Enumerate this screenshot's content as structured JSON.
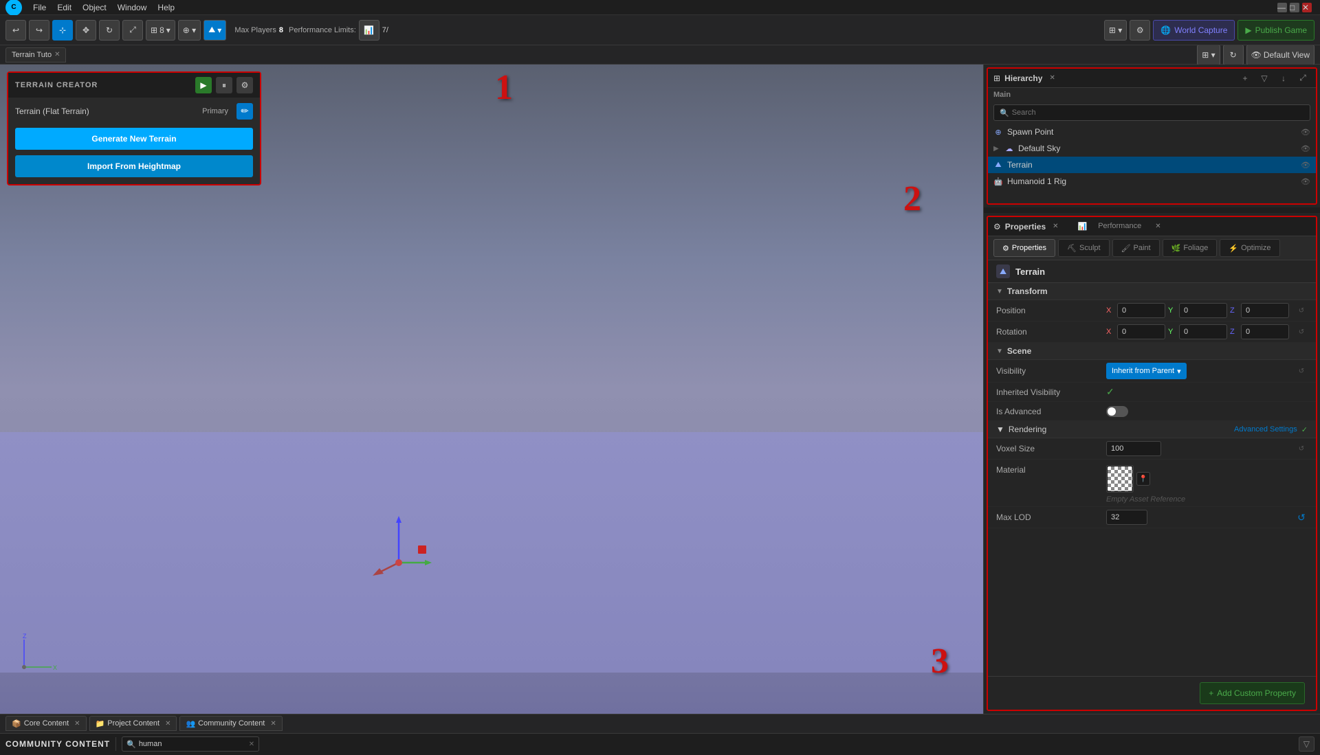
{
  "app": {
    "logo": "C",
    "menu_items": [
      "File",
      "Edit",
      "Object",
      "Window",
      "Help"
    ],
    "title": "Terrain Tuto"
  },
  "toolbar": {
    "max_players_label": "Max Players",
    "max_players_value": "8",
    "performance_limits_label": "Performance Limits:",
    "perf_value": "7/",
    "world_capture": "World Capture",
    "publish_game": "Publish Game",
    "default_view": "Default View"
  },
  "terrain_creator": {
    "title": "TERRAIN CREATOR",
    "terrain_name": "Terrain (Flat Terrain)",
    "primary_label": "Primary",
    "generate_btn": "Generate New Terrain",
    "import_btn": "Import From Heightmap"
  },
  "hierarchy": {
    "title": "Hierarchy",
    "section": "Main",
    "search_placeholder": "Search",
    "items": [
      {
        "icon": "⊕",
        "label": "Spawn Point",
        "color": "#88aaff"
      },
      {
        "icon": "☁",
        "label": "Default Sky",
        "color": "#aaaaff"
      },
      {
        "icon": "⛰",
        "label": "Terrain",
        "color": "#88aaff",
        "selected": true
      },
      {
        "icon": "🤖",
        "label": "Humanoid 1 Rig",
        "color": "#88aaff"
      }
    ]
  },
  "properties": {
    "panel_title": "Properties",
    "close_label": "x",
    "performance_tab": "Performance",
    "tabs": [
      "Properties",
      "Sculpt",
      "Paint",
      "Foliage",
      "Optimize"
    ],
    "object_name": "Terrain",
    "sections": {
      "transform": {
        "title": "Transform",
        "position": {
          "label": "Position",
          "x": "0",
          "y": "0",
          "z": "0"
        },
        "rotation": {
          "label": "Rotation",
          "x": "0",
          "y": "0",
          "z": "0"
        }
      },
      "scene": {
        "title": "Scene",
        "visibility": {
          "label": "Visibility",
          "value": "Inherit from Parent"
        },
        "inherited_visibility": {
          "label": "Inherited Visibility",
          "value": true
        },
        "is_advanced": {
          "label": "Is Advanced",
          "value": false
        }
      },
      "rendering": {
        "title": "Rendering",
        "advanced_settings": "Advanced Settings",
        "voxel_size": {
          "label": "Voxel Size",
          "value": "100"
        },
        "material": {
          "label": "Material",
          "empty_ref": "Empty Asset Reference"
        },
        "max_lod": {
          "label": "Max LOD",
          "value": "32"
        }
      }
    },
    "add_custom_property": "Add Custom Property"
  },
  "bottom_panel": {
    "tabs": [
      {
        "label": "Core Content",
        "closable": true
      },
      {
        "label": "Project Content",
        "closable": true
      },
      {
        "label": "Community Content",
        "closable": true
      }
    ],
    "community_title": "COMMUNITY CONTENT",
    "search_placeholder": "human",
    "search_value": "human"
  },
  "annotations": {
    "one": "1",
    "two": "2",
    "three": "3"
  }
}
